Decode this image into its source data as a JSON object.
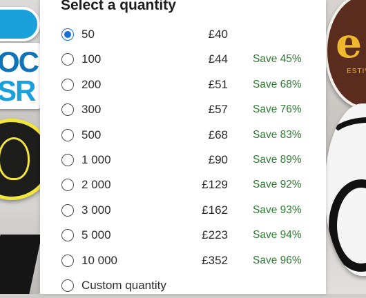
{
  "section": {
    "title": "Select a quantity"
  },
  "options": [
    {
      "qty": "50",
      "price": "£40",
      "save": "",
      "selected": true
    },
    {
      "qty": "100",
      "price": "£44",
      "save": "Save 45%",
      "selected": false
    },
    {
      "qty": "200",
      "price": "£51",
      "save": "Save 68%",
      "selected": false
    },
    {
      "qty": "300",
      "price": "£57",
      "save": "Save 76%",
      "selected": false
    },
    {
      "qty": "500",
      "price": "£68",
      "save": "Save 83%",
      "selected": false
    },
    {
      "qty": "1 000",
      "price": "£90",
      "save": "Save 89%",
      "selected": false
    },
    {
      "qty": "2 000",
      "price": "£129",
      "save": "Save 92%",
      "selected": false
    },
    {
      "qty": "3 000",
      "price": "£162",
      "save": "Save 93%",
      "selected": false
    },
    {
      "qty": "5 000",
      "price": "£223",
      "save": "Save 94%",
      "selected": false
    },
    {
      "qty": "10 000",
      "price": "£352",
      "save": "Save 96%",
      "selected": false
    },
    {
      "qty": "Custom quantity",
      "price": "",
      "save": "",
      "selected": false
    }
  ],
  "background": {
    "sticker_letters_left": [
      "OC",
      "SR"
    ],
    "sticker_letter_right": "e",
    "sticker_text_right": "ESTIVAL"
  },
  "colors": {
    "radio_selected": "#1a6fd6",
    "save_text": "#2e7d32"
  }
}
